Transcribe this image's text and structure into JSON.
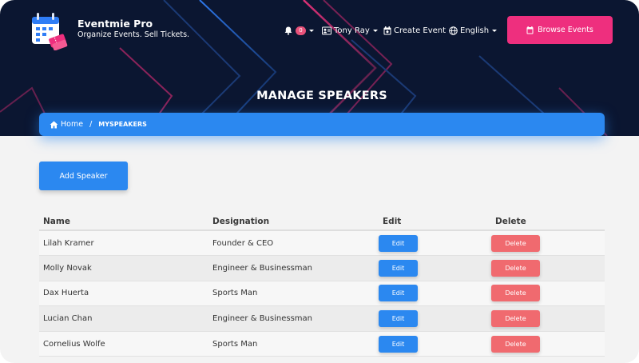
{
  "app": {
    "name": "Eventmie Pro",
    "tagline": "Organize Events. Sell Tickets."
  },
  "nav": {
    "notification_count": "0",
    "user_name": "Tony Ray",
    "create_event": "Create Event",
    "language": "English",
    "browse_events": "Browse Events"
  },
  "page": {
    "title": "MANAGE SPEAKERS",
    "breadcrumb": {
      "home": "Home",
      "separator": "/",
      "current": "MYSPEAKERS"
    },
    "add_button": "Add Speaker"
  },
  "table": {
    "headers": {
      "name": "Name",
      "designation": "Designation",
      "edit": "Edit",
      "delete": "Delete"
    },
    "edit_label": "Edit",
    "delete_label": "Delete",
    "rows": [
      {
        "name": "Lilah Kramer",
        "designation": "Founder & CEO"
      },
      {
        "name": "Molly Novak",
        "designation": "Engineer & Businessman"
      },
      {
        "name": "Dax Huerta",
        "designation": "Sports Man"
      },
      {
        "name": "Lucian Chan",
        "designation": "Engineer & Businessman"
      },
      {
        "name": "Cornelius Wolfe",
        "designation": "Sports Man"
      }
    ]
  },
  "colors": {
    "header_bg": "#0b1631",
    "primary": "#2b88f0",
    "accent_pink": "#ee2f7e",
    "danger": "#f06a6f",
    "badge": "#e8527a"
  },
  "icons": {
    "logo": "calendar-ticket-icon",
    "notifications": "bell-icon",
    "user": "user-card-icon",
    "create_event": "calendar-icon",
    "language": "globe-icon",
    "browse": "ticket-icon",
    "home": "home-icon"
  }
}
